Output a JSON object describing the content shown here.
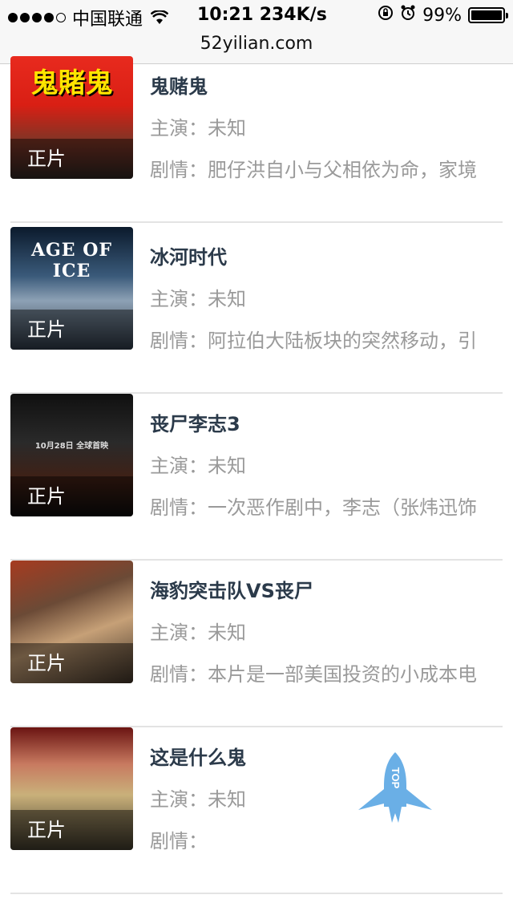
{
  "status_bar": {
    "carrier": "中国联通",
    "time_speed": "10:21 234K/s",
    "battery": "99%",
    "battery_level": 0.99
  },
  "url": "52yilian.com",
  "movies": [
    {
      "title": "鬼赌鬼",
      "cast": "主演：未知",
      "plot": "剧情：肥仔洪自小与父相依为命，家境",
      "tag": "正片",
      "poster_text": "鬼賭鬼"
    },
    {
      "title": "冰河时代",
      "cast": "主演：未知",
      "plot": "剧情：阿拉伯大陆板块的突然移动，引",
      "tag": "正片",
      "poster_text": "AGE OF ICE"
    },
    {
      "title": "丧尸李志3",
      "cast": "主演：未知",
      "plot": "剧情：一次恶作剧中，李志（张炜迅饰",
      "tag": "正片",
      "poster_text": "10月28日 全球首映"
    },
    {
      "title": "海豹突击队VS丧尸",
      "cast": "主演：未知",
      "plot": "剧情：本片是一部美国投资的小成本电",
      "tag": "正片",
      "poster_text": ""
    },
    {
      "title": "这是什么鬼",
      "cast": "主演：未知",
      "plot": "剧情：",
      "tag": "正片",
      "poster_text": ""
    }
  ],
  "top_button": {
    "label": "TOP",
    "icon": "rocket-icon",
    "color": "#6aafe6"
  }
}
